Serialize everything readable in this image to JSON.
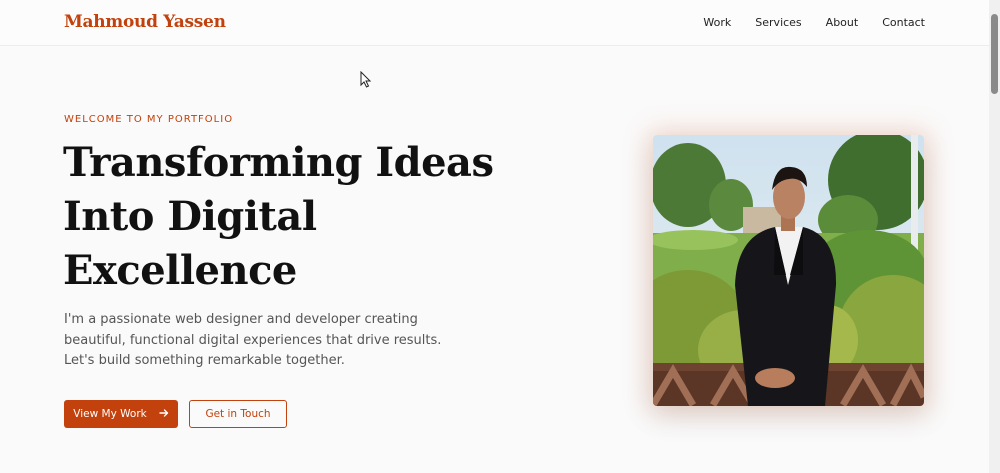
{
  "header": {
    "logo": "Mahmoud Yassen",
    "nav": [
      "Work",
      "Services",
      "About",
      "Contact"
    ]
  },
  "hero": {
    "eyebrow": "WELCOME TO MY PORTFOLIO",
    "headline_lines": [
      "Transforming Ideas",
      "Into Digital",
      "Excellence"
    ],
    "intro_lines": [
      "I'm a passionate web designer and developer creating",
      "beautiful, functional digital experiences that drive results.",
      "Let's build something remarkable together."
    ],
    "primary_button": "View My Work",
    "secondary_button": "Get in Touch"
  },
  "colors": {
    "accent": "#c2410c",
    "background": "#fafafa",
    "text": "#111111"
  },
  "icons": {
    "primary_button_icon": "arrow-right-icon",
    "cursor": "mouse-pointer-icon"
  }
}
